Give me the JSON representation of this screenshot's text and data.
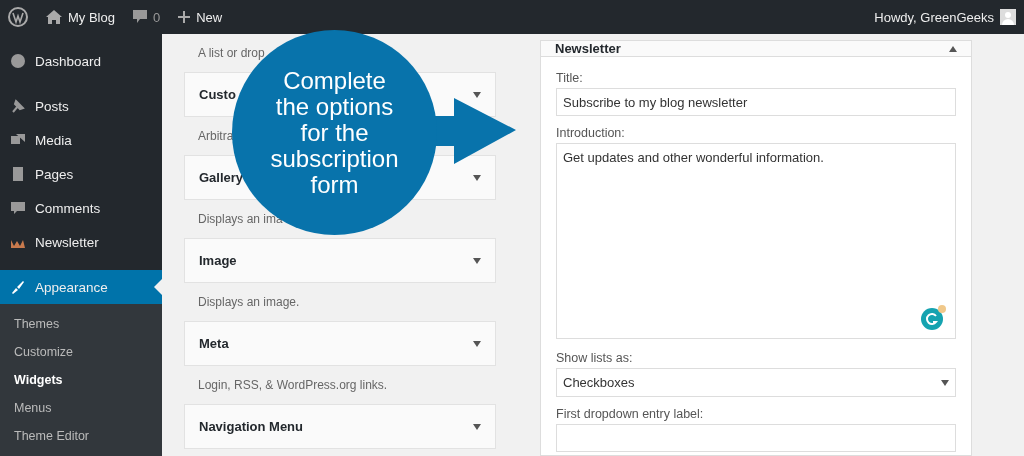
{
  "admin_bar": {
    "site": "My Blog",
    "comments_count": "0",
    "new": "New",
    "greeting": "Howdy, GreenGeeks"
  },
  "sidebar": {
    "items": [
      {
        "label": "Dashboard",
        "selected": false
      },
      {
        "label": "Posts",
        "selected": false
      },
      {
        "label": "Media",
        "selected": false
      },
      {
        "label": "Pages",
        "selected": false
      },
      {
        "label": "Comments",
        "selected": false
      },
      {
        "label": "Newsletter",
        "selected": false
      },
      {
        "label": "Appearance",
        "selected": true
      }
    ],
    "submenu": [
      {
        "label": "Themes",
        "selected": false
      },
      {
        "label": "Customize",
        "selected": false
      },
      {
        "label": "Widgets",
        "selected": true
      },
      {
        "label": "Menus",
        "selected": false
      },
      {
        "label": "Theme Editor",
        "selected": false
      }
    ]
  },
  "available_widgets": {
    "lead_description": "A list or drop",
    "items": [
      {
        "title": "Custo",
        "description": "Arbitra"
      },
      {
        "title": "Gallery",
        "description": "Displays an ima"
      },
      {
        "title": "Image",
        "description": "Displays an image."
      },
      {
        "title": "Meta",
        "description": "Login, RSS, & WordPress.org links."
      },
      {
        "title": "Navigation Menu"
      }
    ]
  },
  "newsletter_widget": {
    "title": "Newsletter",
    "expanded": true,
    "fields": [
      {
        "kind": "text",
        "label": "Title:",
        "value": "Subscribe to my blog newsletter"
      },
      {
        "kind": "textarea",
        "label": "Introduction:",
        "value": "Get updates and other wonderful information."
      },
      {
        "kind": "select",
        "label": "Show lists as:",
        "value": "Checkboxes"
      },
      {
        "kind": "text",
        "label": "First dropdown entry label:"
      }
    ]
  },
  "callout": {
    "text": "Complete the options for the subscription form"
  }
}
